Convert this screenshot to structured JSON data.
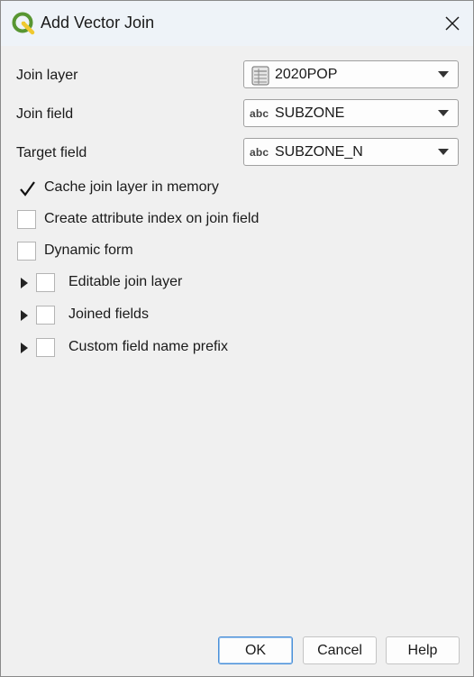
{
  "window": {
    "title": "Add Vector Join",
    "close_glyph": "✕"
  },
  "form": {
    "join_layer": {
      "label": "Join layer",
      "value": "2020POP",
      "icon": "table-icon"
    },
    "join_field": {
      "label": "Join field",
      "value": "SUBZONE",
      "type_badge": "abc"
    },
    "target_field": {
      "label": "Target field",
      "value": "SUBZONE_N",
      "type_badge": "abc"
    }
  },
  "options": {
    "cache_join_layer": {
      "label": "Cache join layer in memory",
      "checked": true
    },
    "create_attribute_index": {
      "label": "Create attribute index on join field",
      "checked": false
    },
    "dynamic_form": {
      "label": "Dynamic form",
      "checked": false
    }
  },
  "groups": {
    "editable_join_layer": {
      "label": "Editable join layer",
      "checked": false,
      "expanded": false
    },
    "joined_fields": {
      "label": "Joined fields",
      "checked": false,
      "expanded": false
    },
    "custom_prefix": {
      "label": "Custom field name prefix",
      "checked": false,
      "expanded": false
    }
  },
  "buttons": {
    "ok": "OK",
    "cancel": "Cancel",
    "help": "Help"
  },
  "colors": {
    "qgis_green": "#589632",
    "qgis_yellow": "#f0c92f",
    "default_button_border": "#4a90d9"
  }
}
